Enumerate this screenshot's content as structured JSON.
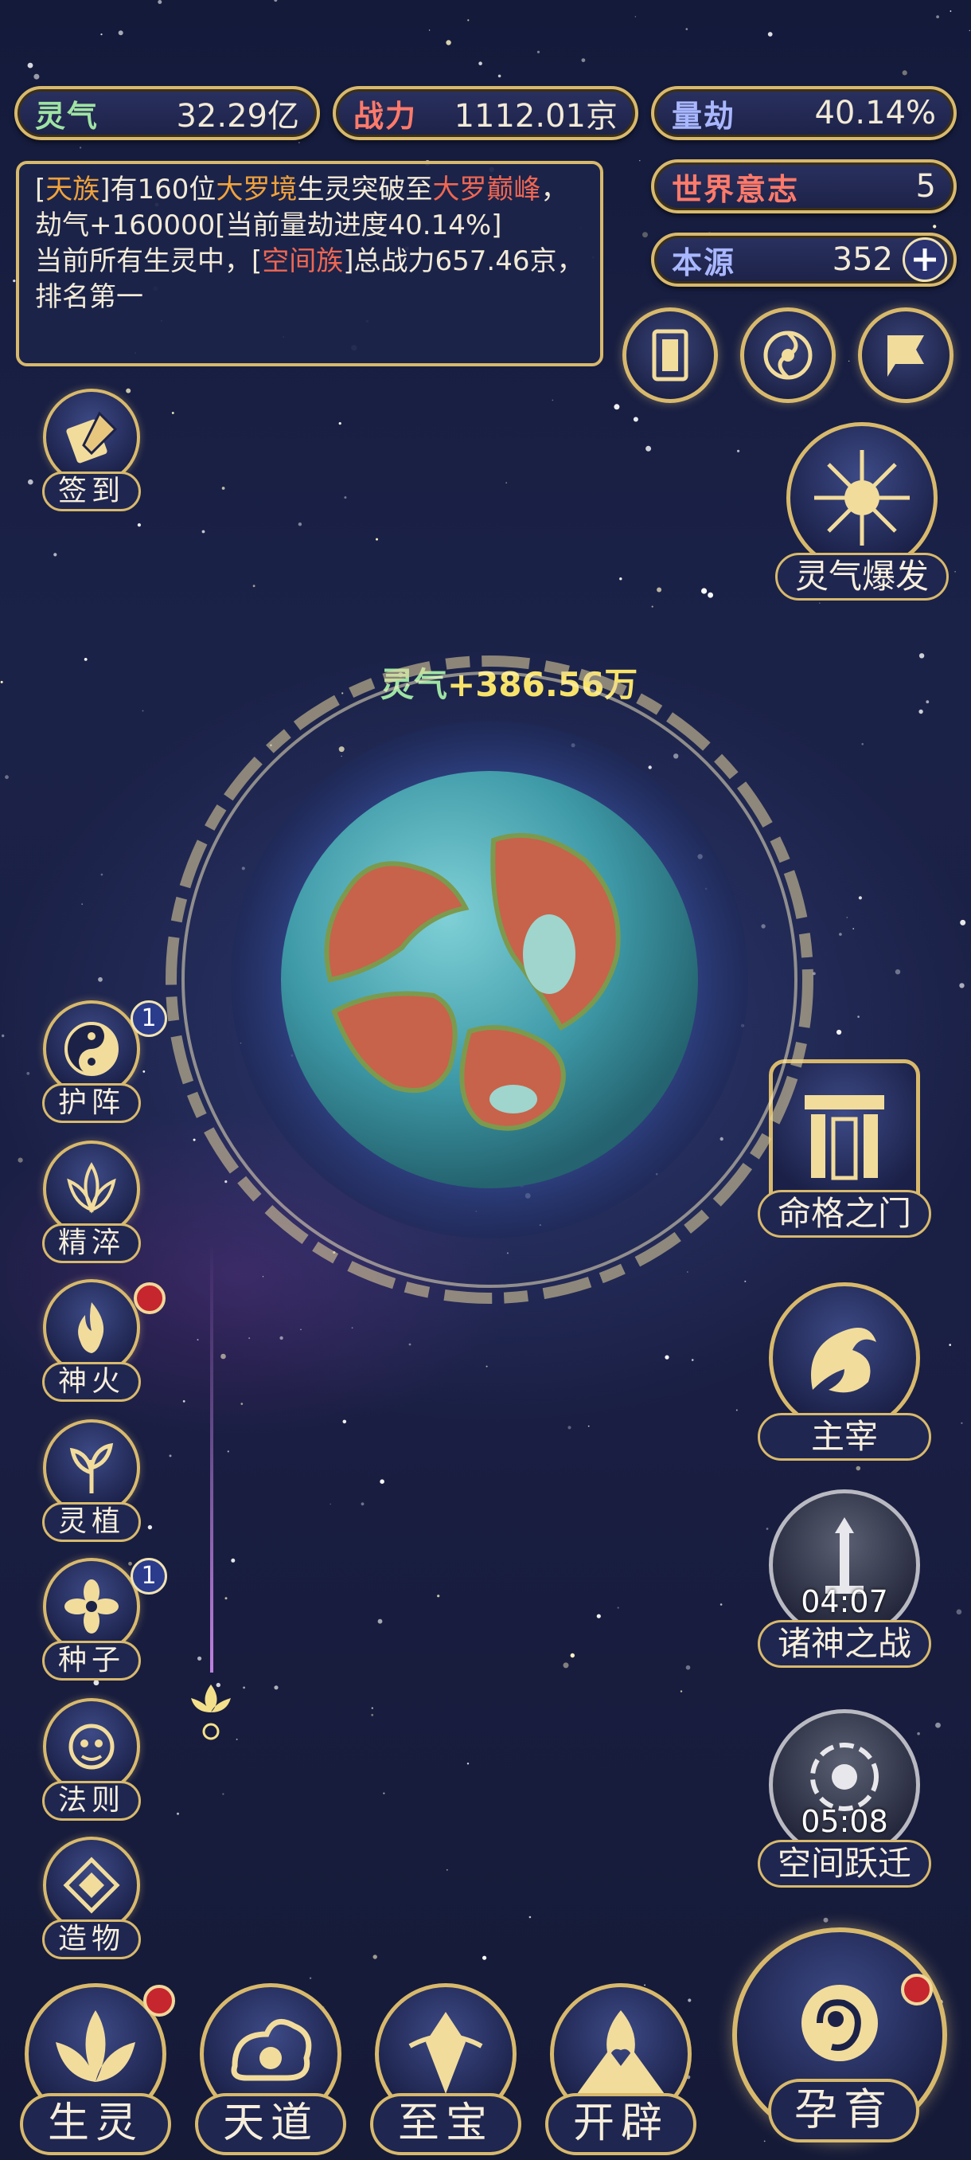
{
  "stats": {
    "lingqi": {
      "label": "灵气",
      "value": "32.29亿"
    },
    "zhanli": {
      "label": "战力",
      "value": "1112.01京"
    },
    "liangjie": {
      "label": "量劫",
      "value": "40.14%"
    },
    "shijie": {
      "label": "世界意志",
      "value": "5"
    },
    "benyuan": {
      "label": "本源",
      "value": "352"
    }
  },
  "log": {
    "line1": {
      "b1": "[",
      "race": "天族",
      "b2": "]有160位",
      "realm": "大罗境",
      "t2": "生灵突破至",
      "realm2": "大罗巅峰",
      "t3": "，劫气+160000[当前量劫进度40.14%]"
    },
    "line2": {
      "t1": "当前所有生灵中，[",
      "race": "空间族",
      "t2": "]总战力657.46京，排名第一"
    }
  },
  "floating": {
    "label": "灵气",
    "value": "+386.56万"
  },
  "left_buttons": [
    {
      "label": "签到",
      "icon": "brush-scroll-icon"
    },
    {
      "label": "护阵",
      "icon": "yin-yang-icon",
      "badge": "1"
    },
    {
      "label": "精淬",
      "icon": "lotus-icon"
    },
    {
      "label": "神火",
      "icon": "flame-icon",
      "dot": true
    },
    {
      "label": "灵植",
      "icon": "plant-icon"
    },
    {
      "label": "种子",
      "icon": "seed-flower-icon",
      "badge": "1"
    },
    {
      "label": "法则",
      "icon": "rune-face-icon"
    },
    {
      "label": "造物",
      "icon": "diamond-rune-icon"
    }
  ],
  "right_buttons": [
    {
      "label": "灵气爆发",
      "icon": "burst-icon"
    },
    {
      "label": "命格之门",
      "icon": "gate-icon"
    },
    {
      "label": "主宰",
      "icon": "dragon-icon"
    },
    {
      "label": "诸神之战",
      "icon": "sword-icon",
      "timer": "04:07"
    },
    {
      "label": "空间跃迁",
      "icon": "portal-icon",
      "timer": "05:08"
    }
  ],
  "top_icons": [
    "card-icon",
    "swirl-icon",
    "flag-icon"
  ],
  "bottom_buttons": [
    {
      "label": "生灵",
      "icon": "lotus-spirit-icon",
      "dot": true
    },
    {
      "label": "天道",
      "icon": "cloud-swirl-icon"
    },
    {
      "label": "至宝",
      "icon": "treasure-icon"
    },
    {
      "label": "开辟",
      "icon": "mountain-flame-icon"
    }
  ],
  "main_button": {
    "label": "孕育",
    "icon": "embryo-icon",
    "dot": true
  },
  "colors": {
    "gold": "#d8b96c",
    "panel": "#1f2650",
    "lingqi_label": "#9fe3a3",
    "zhanli_label": "#ff7a6a",
    "highlight_orange": "#f0a23b",
    "highlight_red": "#ef6752",
    "badge_red": "#c6262e"
  }
}
